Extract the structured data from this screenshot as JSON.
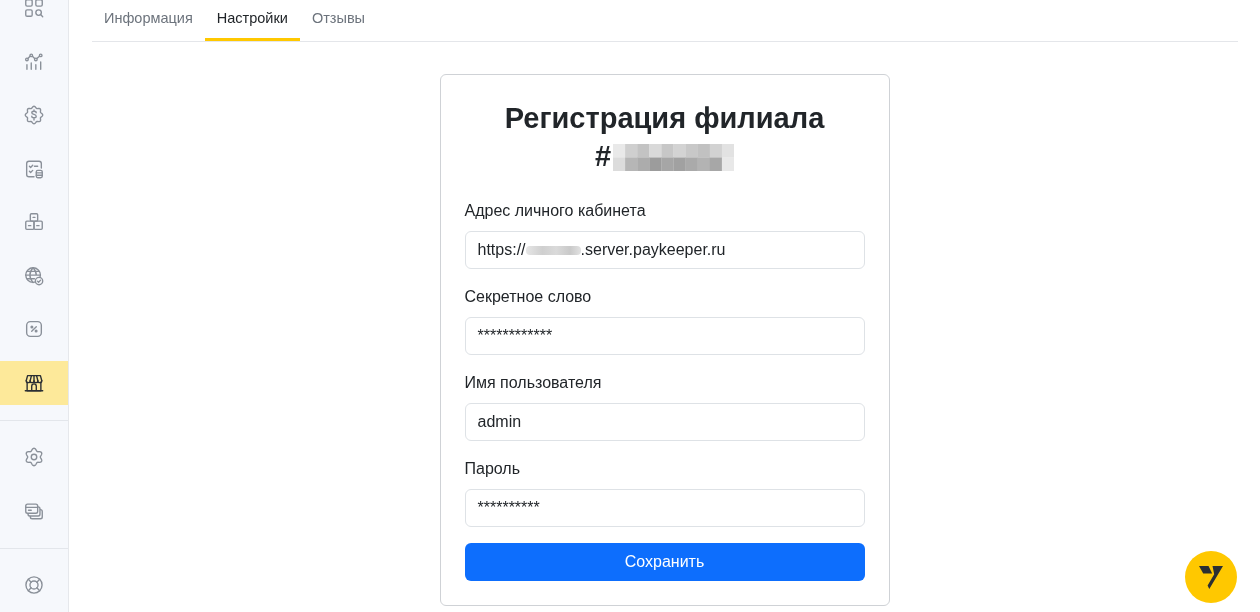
{
  "sidebar": {
    "groups": [
      {
        "items": [
          {
            "selected": false
          },
          {
            "selected": false
          },
          {
            "selected": false
          },
          {
            "selected": false
          },
          {
            "selected": false
          },
          {
            "selected": false
          },
          {
            "selected": false
          },
          {
            "selected": true
          }
        ]
      },
      {
        "items": [
          {
            "selected": false
          },
          {
            "selected": false
          }
        ]
      },
      {
        "items": [
          {
            "selected": false
          }
        ]
      }
    ]
  },
  "tabs": [
    {
      "label": "Информация",
      "selected": false
    },
    {
      "label": "Настройки",
      "selected": true
    },
    {
      "label": "Отзывы",
      "selected": false
    }
  ],
  "form": {
    "title": "Регистрация филиала",
    "number_sign": "#",
    "number_redacted": true,
    "fields": [
      {
        "label": "Адрес личного кабинета",
        "value": "https://",
        "value_redacted": true,
        "value_end": ".server.paykeeper.ru"
      },
      {
        "label": "Секретное слово",
        "value": "************",
        "value_redacted": false
      },
      {
        "label": "Имя пользователя",
        "value": "admin",
        "value_redacted": false
      },
      {
        "label": "Пароль",
        "value": "**********",
        "value_redacted": false
      }
    ],
    "submit_button": "Сохранить"
  }
}
